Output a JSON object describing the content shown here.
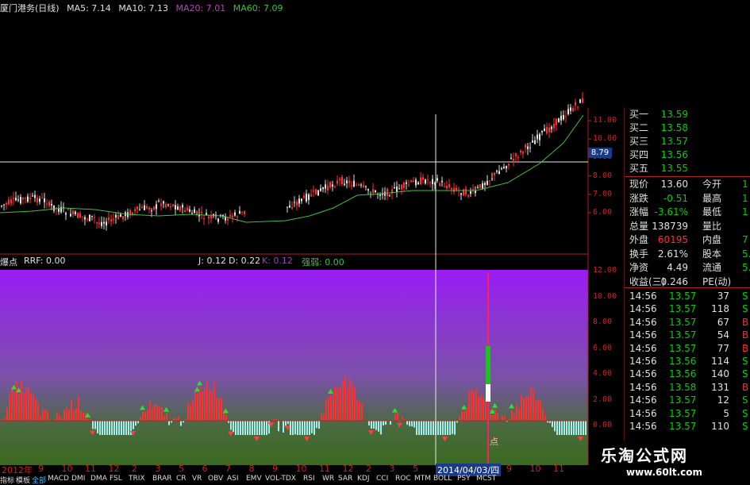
{
  "title_bar": {
    "stock": "厦门港务(日线)",
    "ma5": "MA5: 7.14",
    "ma10": "MA10: 7.13",
    "ma20": "MA20: 7.01",
    "ma60": "MA60: 7.09"
  },
  "price_axis": [
    "11.00",
    "10.00",
    "9.00",
    "8.00",
    "7.00",
    "6.00"
  ],
  "cursor_price": "8.79",
  "indicator_bar": {
    "name": "爆点",
    "rrf": "RRF: 0.00",
    "j": "J: 0.12",
    "d": "D: 0.22",
    "k": "K: 0.12",
    "extra": "强弱: 0.00"
  },
  "indicator_axis": [
    "12.00",
    "10.00",
    "8.00",
    "6.00",
    "4.00",
    "2.00",
    "0.00"
  ],
  "marker_label": "点",
  "date_axis": {
    "year": "2012年",
    "months": [
      "9",
      "10",
      "11",
      "12",
      "2",
      "3",
      "5",
      "6",
      "7",
      "8",
      "9",
      "10",
      "11",
      "12",
      "2",
      "3",
      "5",
      "6",
      "7",
      "8",
      "9",
      "10",
      "11"
    ],
    "cursor_date": "2014/04/03/四"
  },
  "tabs": [
    "指标",
    "模板",
    "全部",
    "MACD",
    "DMI",
    "DMA",
    "FSL",
    "TRIX",
    "BRAR",
    "CR",
    "VR",
    "OBV",
    "ASI",
    "EMV",
    "VOL-TDX",
    "RSI",
    "WR",
    "SAR",
    "KDJ",
    "CCI",
    "ROC",
    "MTM",
    "BOLL",
    "PSY",
    "MCST"
  ],
  "quotes": {
    "bids": [
      {
        "label": "买一",
        "value": "13.59"
      },
      {
        "label": "买二",
        "value": "13.58"
      },
      {
        "label": "买三",
        "value": "13.57"
      },
      {
        "label": "买四",
        "value": "13.56"
      },
      {
        "label": "买五",
        "value": "13.55"
      }
    ],
    "stats": [
      {
        "label": "现价",
        "value": "13.60",
        "value_color": "#e0e0e0",
        "label2": "今开",
        "value2": "1"
      },
      {
        "label": "涨跌",
        "value": "-0.51",
        "value_color": "#00d000",
        "label2": "最高",
        "value2": "1"
      },
      {
        "label": "涨幅",
        "value": "-3.61%",
        "value_color": "#00d000",
        "label2": "最低",
        "value2": "1"
      },
      {
        "label": "总量",
        "value": "138739",
        "value_color": "#e0e0e0",
        "label2": "量比",
        "value2": ""
      },
      {
        "label": "外盘",
        "value": "60195",
        "value_color": "#ff3030",
        "label2": "内盘",
        "value2": "7"
      },
      {
        "label": "换手",
        "value": "2.61%",
        "value_color": "#e0e0e0",
        "label2": "股本",
        "value2": "5."
      },
      {
        "label": "净资",
        "value": "4.49",
        "value_color": "#e0e0e0",
        "label2": "流通",
        "value2": "5."
      },
      {
        "label": "收益(三)",
        "value": "0.246",
        "value_color": "#e0e0e0",
        "label2": "PE(动)",
        "value2": ""
      }
    ],
    "ticks": [
      {
        "time": "14:56",
        "price": "13.57",
        "vol": "37",
        "side": "S"
      },
      {
        "time": "14:56",
        "price": "13.57",
        "vol": "118",
        "side": "S"
      },
      {
        "time": "14:56",
        "price": "13.57",
        "vol": "67",
        "side": "B"
      },
      {
        "time": "14:56",
        "price": "13.57",
        "vol": "54",
        "side": "B"
      },
      {
        "time": "14:56",
        "price": "13.57",
        "vol": "77",
        "side": "B"
      },
      {
        "time": "14:56",
        "price": "13.56",
        "vol": "114",
        "side": "S"
      },
      {
        "time": "14:56",
        "price": "13.56",
        "vol": "140",
        "side": "S"
      },
      {
        "time": "14:56",
        "price": "13.58",
        "vol": "131",
        "side": "B"
      },
      {
        "time": "14:56",
        "price": "13.57",
        "vol": "12",
        "side": "S"
      },
      {
        "time": "14:56",
        "price": "13.57",
        "vol": "5",
        "side": "S"
      },
      {
        "time": "14:56",
        "price": "13.57",
        "vol": "110",
        "side": "S"
      }
    ]
  },
  "watermark": {
    "brand": "乐淘公式网",
    "url": "www.60lt.com"
  },
  "colors": {
    "up": "#ff3030",
    "down": "#00d000",
    "axis": "#d02020",
    "ma20": "#c040c0",
    "ma60": "#40c040"
  }
}
